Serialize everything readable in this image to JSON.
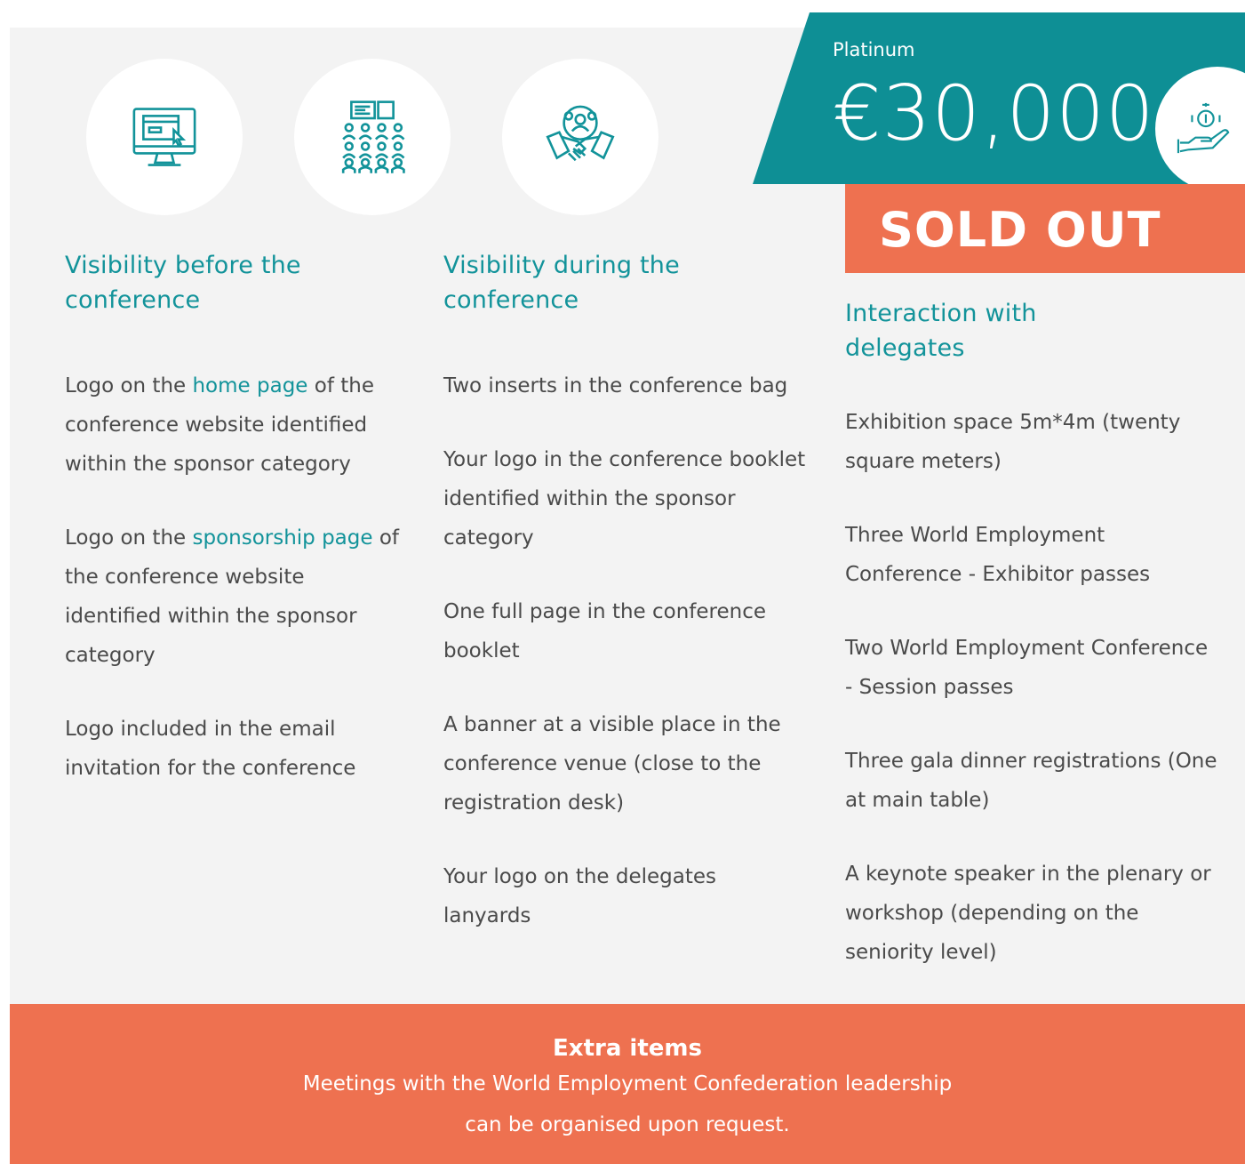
{
  "columns": [
    {
      "title": "Visibility before the conference",
      "items": [
        {
          "pre": "Logo on the ",
          "link": "home page",
          "post": " of the conference website identified within the sponsor category"
        },
        {
          "pre": "Logo on the ",
          "link": "sponsorship page",
          "post": " of the conference website identified within the sponsor category"
        },
        {
          "pre": "Logo included in the email invitation for the conference"
        }
      ]
    },
    {
      "title": "Visibility during the conference",
      "items": [
        "Two inserts in the conference bag",
        "Your logo in the conference booklet identified within the sponsor category",
        "One full page in the conference booklet",
        "A banner at a visible place in the conference venue (close to the registration desk)",
        "Your logo on the delegates lanyards"
      ]
    },
    {
      "title": "Interaction with delegates",
      "items": [
        "Exhibition space 5m*4m (twenty square meters)",
        "Three World Employment Conference - Exhibitor passes",
        "Two World Employment Conference - Session passes",
        "Three gala dinner registrations (One at main table)",
        "A keynote speaker in the plenary or workshop (depending on the seniority level)"
      ]
    }
  ],
  "icons": [
    "computer-screen-icon",
    "audience-presentation-icon",
    "handshake-team-icon",
    "hand-coins-icon"
  ],
  "price": {
    "tier": "Platinum",
    "amount": "€30,000",
    "status": "SOLD OUT"
  },
  "extra": {
    "title": "Extra items",
    "line1": "Meetings with the World Employment Confederation leadership",
    "line2": "can be organised upon request."
  },
  "colors": {
    "teal": "#0e8f95",
    "accent_text": "#12939a",
    "orange": "#ee7150",
    "panel": "#f3f3f3"
  }
}
